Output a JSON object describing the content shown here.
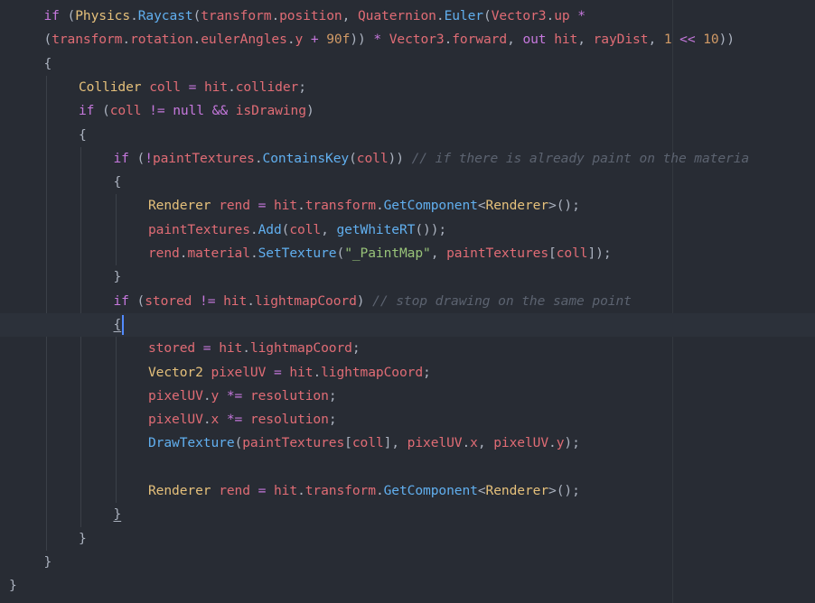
{
  "editor": {
    "colors": {
      "background": "#282c34",
      "keyword": "#c678dd",
      "identifier": "#e06c75",
      "function": "#61afef",
      "type": "#e5c07b",
      "number": "#d19a66",
      "string": "#98c379",
      "comment": "#5c6370",
      "cursor": "#528bff"
    },
    "lines": [
      {
        "indent": 1,
        "tokens": [
          {
            "t": "if",
            "c": "kw"
          },
          {
            "t": " (",
            "c": "p"
          },
          {
            "t": "Physics",
            "c": "type"
          },
          {
            "t": ".",
            "c": "p"
          },
          {
            "t": "Raycast",
            "c": "fn"
          },
          {
            "t": "(",
            "c": "p"
          },
          {
            "t": "transform",
            "c": "id"
          },
          {
            "t": ".",
            "c": "p"
          },
          {
            "t": "position",
            "c": "id"
          },
          {
            "t": ", ",
            "c": "p"
          },
          {
            "t": "Quaternion",
            "c": "id"
          },
          {
            "t": ".",
            "c": "p"
          },
          {
            "t": "Euler",
            "c": "fn"
          },
          {
            "t": "(",
            "c": "p"
          },
          {
            "t": "Vector3",
            "c": "id"
          },
          {
            "t": ".",
            "c": "p"
          },
          {
            "t": "up",
            "c": "id"
          },
          {
            "t": " *",
            "c": "op"
          }
        ]
      },
      {
        "indent": 1,
        "tokens": [
          {
            "t": "(",
            "c": "p"
          },
          {
            "t": "transform",
            "c": "id"
          },
          {
            "t": ".",
            "c": "p"
          },
          {
            "t": "rotation",
            "c": "id"
          },
          {
            "t": ".",
            "c": "p"
          },
          {
            "t": "eulerAngles",
            "c": "id"
          },
          {
            "t": ".",
            "c": "p"
          },
          {
            "t": "y",
            "c": "id"
          },
          {
            "t": " + ",
            "c": "op"
          },
          {
            "t": "90f",
            "c": "num"
          },
          {
            "t": ")) ",
            "c": "p"
          },
          {
            "t": "*",
            "c": "op"
          },
          {
            "t": " ",
            "c": "p"
          },
          {
            "t": "Vector3",
            "c": "id"
          },
          {
            "t": ".",
            "c": "p"
          },
          {
            "t": "forward",
            "c": "id"
          },
          {
            "t": ", ",
            "c": "p"
          },
          {
            "t": "out",
            "c": "kw"
          },
          {
            "t": " ",
            "c": "p"
          },
          {
            "t": "hit",
            "c": "id"
          },
          {
            "t": ", ",
            "c": "p"
          },
          {
            "t": "rayDist",
            "c": "id"
          },
          {
            "t": ", ",
            "c": "p"
          },
          {
            "t": "1",
            "c": "num"
          },
          {
            "t": " << ",
            "c": "op"
          },
          {
            "t": "10",
            "c": "num"
          },
          {
            "t": "))",
            "c": "p"
          }
        ]
      },
      {
        "indent": 1,
        "tokens": [
          {
            "t": "{",
            "c": "brace"
          }
        ]
      },
      {
        "indent": 2,
        "tokens": [
          {
            "t": "Collider",
            "c": "type"
          },
          {
            "t": " ",
            "c": "p"
          },
          {
            "t": "coll",
            "c": "id"
          },
          {
            "t": " = ",
            "c": "op"
          },
          {
            "t": "hit",
            "c": "id"
          },
          {
            "t": ".",
            "c": "p"
          },
          {
            "t": "collider",
            "c": "id"
          },
          {
            "t": ";",
            "c": "p"
          }
        ]
      },
      {
        "indent": 2,
        "tokens": [
          {
            "t": "if",
            "c": "kw"
          },
          {
            "t": " (",
            "c": "p"
          },
          {
            "t": "coll",
            "c": "id"
          },
          {
            "t": " != ",
            "c": "op"
          },
          {
            "t": "null",
            "c": "kw"
          },
          {
            "t": " && ",
            "c": "op"
          },
          {
            "t": "isDrawing",
            "c": "id"
          },
          {
            "t": ")",
            "c": "p"
          }
        ]
      },
      {
        "indent": 2,
        "tokens": [
          {
            "t": "{",
            "c": "brace"
          }
        ]
      },
      {
        "indent": 3,
        "tokens": [
          {
            "t": "if",
            "c": "kw"
          },
          {
            "t": " (",
            "c": "p"
          },
          {
            "t": "!",
            "c": "op"
          },
          {
            "t": "paintTextures",
            "c": "id"
          },
          {
            "t": ".",
            "c": "p"
          },
          {
            "t": "ContainsKey",
            "c": "fn"
          },
          {
            "t": "(",
            "c": "p"
          },
          {
            "t": "coll",
            "c": "id"
          },
          {
            "t": ")) ",
            "c": "p"
          },
          {
            "t": "// if there is already paint on the materia",
            "c": "cmt"
          }
        ]
      },
      {
        "indent": 3,
        "tokens": [
          {
            "t": "{",
            "c": "brace"
          }
        ]
      },
      {
        "indent": 4,
        "tokens": [
          {
            "t": "Renderer",
            "c": "type"
          },
          {
            "t": " ",
            "c": "p"
          },
          {
            "t": "rend",
            "c": "id"
          },
          {
            "t": " = ",
            "c": "op"
          },
          {
            "t": "hit",
            "c": "id"
          },
          {
            "t": ".",
            "c": "p"
          },
          {
            "t": "transform",
            "c": "id"
          },
          {
            "t": ".",
            "c": "p"
          },
          {
            "t": "GetComponent",
            "c": "fn"
          },
          {
            "t": "<",
            "c": "p"
          },
          {
            "t": "Renderer",
            "c": "type"
          },
          {
            "t": ">();",
            "c": "p"
          }
        ]
      },
      {
        "indent": 4,
        "tokens": [
          {
            "t": "paintTextures",
            "c": "id"
          },
          {
            "t": ".",
            "c": "p"
          },
          {
            "t": "Add",
            "c": "fn"
          },
          {
            "t": "(",
            "c": "p"
          },
          {
            "t": "coll",
            "c": "id"
          },
          {
            "t": ", ",
            "c": "p"
          },
          {
            "t": "getWhiteRT",
            "c": "fn"
          },
          {
            "t": "());",
            "c": "p"
          }
        ]
      },
      {
        "indent": 4,
        "tokens": [
          {
            "t": "rend",
            "c": "id"
          },
          {
            "t": ".",
            "c": "p"
          },
          {
            "t": "material",
            "c": "id"
          },
          {
            "t": ".",
            "c": "p"
          },
          {
            "t": "SetTexture",
            "c": "fn"
          },
          {
            "t": "(",
            "c": "p"
          },
          {
            "t": "\"_PaintMap\"",
            "c": "str"
          },
          {
            "t": ", ",
            "c": "p"
          },
          {
            "t": "paintTextures",
            "c": "id"
          },
          {
            "t": "[",
            "c": "p"
          },
          {
            "t": "coll",
            "c": "id"
          },
          {
            "t": "]);",
            "c": "p"
          }
        ]
      },
      {
        "indent": 3,
        "tokens": [
          {
            "t": "}",
            "c": "brace"
          }
        ]
      },
      {
        "indent": 3,
        "tokens": [
          {
            "t": "if",
            "c": "kw"
          },
          {
            "t": " (",
            "c": "p"
          },
          {
            "t": "stored",
            "c": "id"
          },
          {
            "t": " != ",
            "c": "op"
          },
          {
            "t": "hit",
            "c": "id"
          },
          {
            "t": ".",
            "c": "p"
          },
          {
            "t": "lightmapCoord",
            "c": "id"
          },
          {
            "t": ") ",
            "c": "p"
          },
          {
            "t": "// stop drawing on the same point",
            "c": "cmt"
          }
        ]
      },
      {
        "indent": 3,
        "active": true,
        "cursor": true,
        "tokens": [
          {
            "t": "{",
            "c": "brace-match"
          }
        ]
      },
      {
        "indent": 4,
        "tokens": [
          {
            "t": "stored",
            "c": "id"
          },
          {
            "t": " = ",
            "c": "op"
          },
          {
            "t": "hit",
            "c": "id"
          },
          {
            "t": ".",
            "c": "p"
          },
          {
            "t": "lightmapCoord",
            "c": "id"
          },
          {
            "t": ";",
            "c": "p"
          }
        ]
      },
      {
        "indent": 4,
        "tokens": [
          {
            "t": "Vector2",
            "c": "type"
          },
          {
            "t": " ",
            "c": "p"
          },
          {
            "t": "pixelUV",
            "c": "id"
          },
          {
            "t": " = ",
            "c": "op"
          },
          {
            "t": "hit",
            "c": "id"
          },
          {
            "t": ".",
            "c": "p"
          },
          {
            "t": "lightmapCoord",
            "c": "id"
          },
          {
            "t": ";",
            "c": "p"
          }
        ]
      },
      {
        "indent": 4,
        "tokens": [
          {
            "t": "pixelUV",
            "c": "id"
          },
          {
            "t": ".",
            "c": "p"
          },
          {
            "t": "y",
            "c": "id"
          },
          {
            "t": " *= ",
            "c": "op"
          },
          {
            "t": "resolution",
            "c": "id"
          },
          {
            "t": ";",
            "c": "p"
          }
        ]
      },
      {
        "indent": 4,
        "tokens": [
          {
            "t": "pixelUV",
            "c": "id"
          },
          {
            "t": ".",
            "c": "p"
          },
          {
            "t": "x",
            "c": "id"
          },
          {
            "t": " *= ",
            "c": "op"
          },
          {
            "t": "resolution",
            "c": "id"
          },
          {
            "t": ";",
            "c": "p"
          }
        ]
      },
      {
        "indent": 4,
        "tokens": [
          {
            "t": "DrawTexture",
            "c": "fn"
          },
          {
            "t": "(",
            "c": "p"
          },
          {
            "t": "paintTextures",
            "c": "id"
          },
          {
            "t": "[",
            "c": "p"
          },
          {
            "t": "coll",
            "c": "id"
          },
          {
            "t": "], ",
            "c": "p"
          },
          {
            "t": "pixelUV",
            "c": "id"
          },
          {
            "t": ".",
            "c": "p"
          },
          {
            "t": "x",
            "c": "id"
          },
          {
            "t": ", ",
            "c": "p"
          },
          {
            "t": "pixelUV",
            "c": "id"
          },
          {
            "t": ".",
            "c": "p"
          },
          {
            "t": "y",
            "c": "id"
          },
          {
            "t": ");",
            "c": "p"
          }
        ]
      },
      {
        "indent": 4,
        "tokens": []
      },
      {
        "indent": 4,
        "tokens": [
          {
            "t": "Renderer",
            "c": "type"
          },
          {
            "t": " ",
            "c": "p"
          },
          {
            "t": "rend",
            "c": "id"
          },
          {
            "t": " = ",
            "c": "op"
          },
          {
            "t": "hit",
            "c": "id"
          },
          {
            "t": ".",
            "c": "p"
          },
          {
            "t": "transform",
            "c": "id"
          },
          {
            "t": ".",
            "c": "p"
          },
          {
            "t": "GetComponent",
            "c": "fn"
          },
          {
            "t": "<",
            "c": "p"
          },
          {
            "t": "Renderer",
            "c": "type"
          },
          {
            "t": ">();",
            "c": "p"
          }
        ]
      },
      {
        "indent": 3,
        "tokens": [
          {
            "t": "}",
            "c": "brace-match"
          }
        ]
      },
      {
        "indent": 2,
        "tokens": [
          {
            "t": "}",
            "c": "brace"
          }
        ]
      },
      {
        "indent": 1,
        "tokens": [
          {
            "t": "}",
            "c": "brace"
          }
        ]
      },
      {
        "indent": 0,
        "tokens": [
          {
            "t": "}",
            "c": "brace"
          }
        ]
      }
    ]
  }
}
